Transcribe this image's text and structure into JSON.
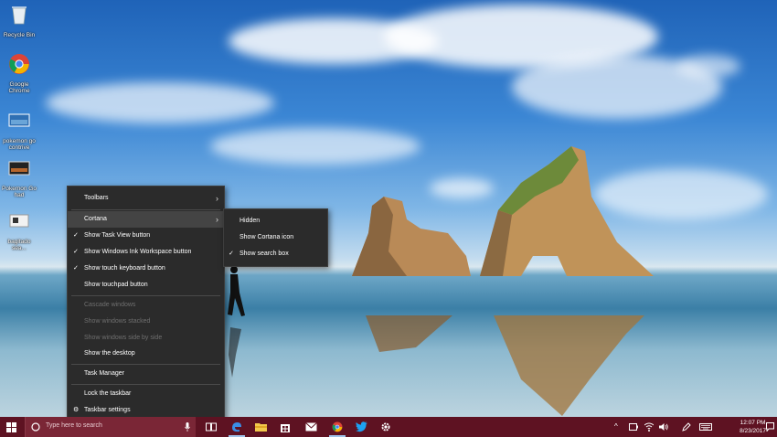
{
  "desktop_icons": [
    {
      "label": "Recycle Bin",
      "icon": "recycle-bin-icon"
    },
    {
      "label": "Google\nChrome",
      "icon": "chrome-icon"
    },
    {
      "label": "pokemon go\ncontrive",
      "icon": "image-file-icon"
    },
    {
      "label": "Pokemon Go\nhad",
      "icon": "image-file-icon"
    },
    {
      "label": "bagitado sea...",
      "icon": "image-file-icon"
    }
  ],
  "context_menu": {
    "items": [
      {
        "label": "Toolbars"
      },
      {
        "label": "Cortana"
      },
      {
        "label": "Show Task View button"
      },
      {
        "label": "Show Windows Ink Workspace button"
      },
      {
        "label": "Show touch keyboard button"
      },
      {
        "label": "Show touchpad button"
      },
      {
        "label": "Cascade windows"
      },
      {
        "label": "Show windows stacked"
      },
      {
        "label": "Show windows side by side"
      },
      {
        "label": "Show the desktop"
      },
      {
        "label": "Task Manager"
      },
      {
        "label": "Lock the taskbar"
      },
      {
        "label": "Taskbar settings"
      }
    ]
  },
  "cortana_submenu": {
    "items": [
      {
        "label": "Hidden"
      },
      {
        "label": "Show Cortana icon"
      },
      {
        "label": "Show search box"
      }
    ]
  },
  "taskbar": {
    "search_placeholder": "Type here to search",
    "pinned": [
      "task-view-icon",
      "edge-icon",
      "file-explorer-icon",
      "store-icon",
      "mail-icon",
      "chrome-icon",
      "twitter-icon",
      "settings-icon"
    ],
    "time": "12:07 PM",
    "date": "8/23/2017",
    "colors": {
      "taskbar": "#5e1222",
      "search": "#7a2636",
      "edge": "#3b8ee6",
      "twitter": "#1da1f2"
    }
  }
}
